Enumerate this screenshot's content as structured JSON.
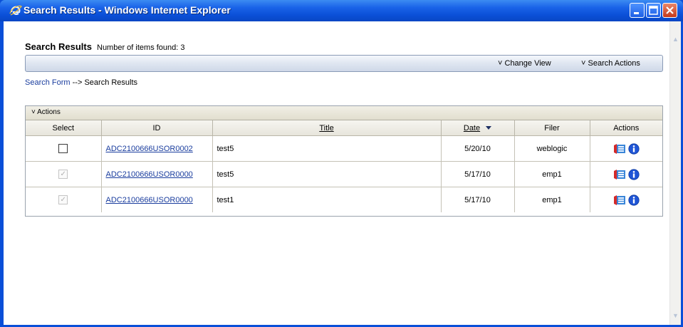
{
  "window": {
    "title": "Search Results - Windows Internet Explorer"
  },
  "page": {
    "heading": "Search Results",
    "count_text": "Number of items found: 3"
  },
  "view_bar": {
    "change_view": "Change View",
    "search_actions": "Search Actions"
  },
  "breadcrumb": {
    "link": "Search Form",
    "separator": "-->",
    "current": "Search Results"
  },
  "actions_bar": {
    "label": "Actions"
  },
  "table": {
    "columns": [
      "Select",
      "ID",
      "Title",
      "Date",
      "Filer",
      "Actions"
    ],
    "sorted_column": "Date",
    "rows": [
      {
        "checked": false,
        "id": "ADC2100666USOR0002",
        "title": "test5",
        "date": "5/20/10",
        "filer": "weblogic"
      },
      {
        "checked": true,
        "id": "ADC2100666USOR0000",
        "title": "test5",
        "date": "5/17/10",
        "filer": "emp1"
      },
      {
        "checked": true,
        "id": "ADC2100666USOR0000",
        "title": "test1",
        "date": "5/17/10",
        "filer": "emp1"
      }
    ]
  },
  "icons": {
    "row_actions": [
      "document-view-icon",
      "info-icon"
    ],
    "browser": "ie-logo-icon"
  },
  "colors": {
    "titlebar": "#0b50d8",
    "link": "#1a3d9e",
    "info_icon": "#1f55d6"
  }
}
